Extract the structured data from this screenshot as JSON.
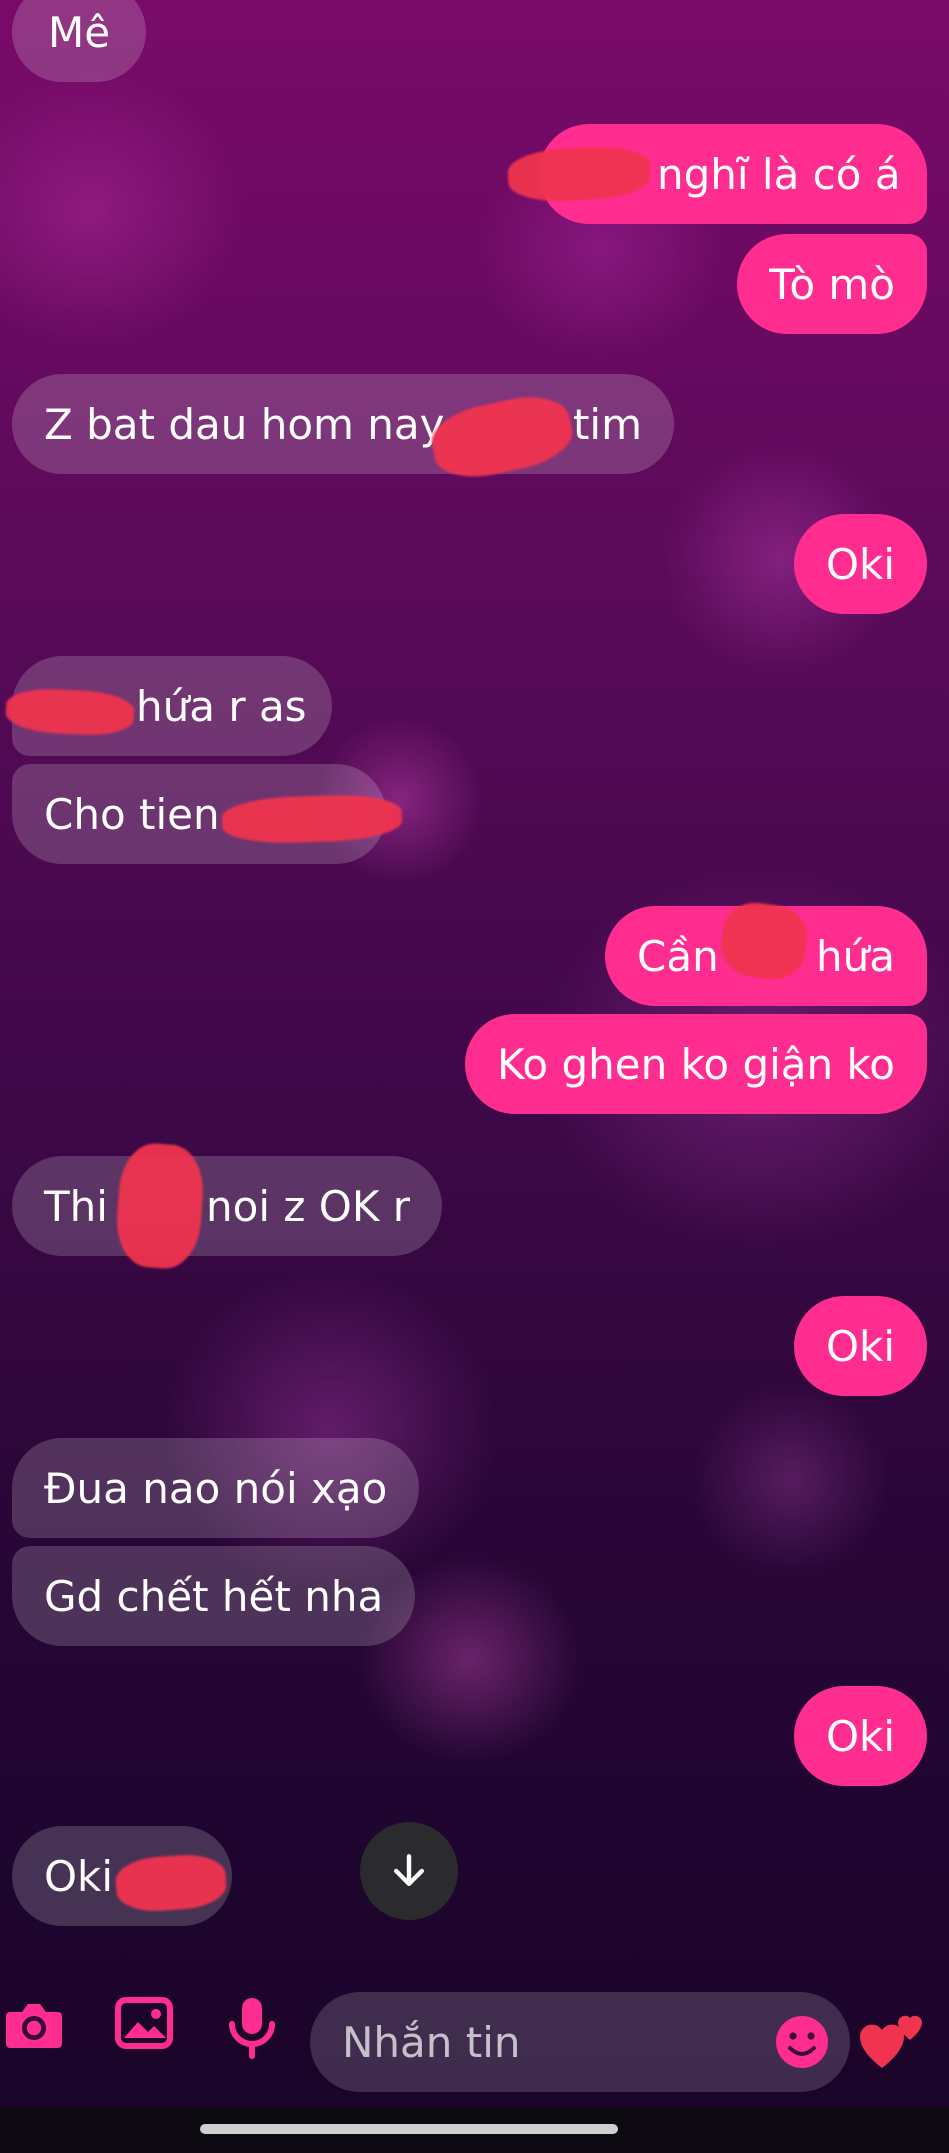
{
  "messages": [
    {
      "dir": "recv",
      "text": "Mê"
    },
    {
      "dir": "sent",
      "text": "nghĩ là có á"
    },
    {
      "dir": "sent",
      "text": "Tò mò"
    },
    {
      "dir": "recv",
      "text": "Z bat dau hom nay",
      "tail": "tim"
    },
    {
      "dir": "sent",
      "text": "Oki"
    },
    {
      "dir": "recv",
      "text": "hứa r as"
    },
    {
      "dir": "recv",
      "text": "Cho tien"
    },
    {
      "dir": "sent",
      "text": "Cần",
      "tail": "hứa"
    },
    {
      "dir": "sent",
      "text": "Ko ghen ko giận ko"
    },
    {
      "dir": "recv",
      "text": "Thi",
      "tail": "noi z OK r"
    },
    {
      "dir": "sent",
      "text": "Oki"
    },
    {
      "dir": "recv",
      "text": "Đua nao nói xạo"
    },
    {
      "dir": "recv",
      "text": "Gd chết hết nha"
    },
    {
      "dir": "sent",
      "text": "Oki"
    },
    {
      "dir": "recv",
      "text": "Oki"
    }
  ],
  "composer": {
    "placeholder": "Nhắn tin",
    "icons": [
      "camera-icon",
      "image-icon",
      "mic-icon",
      "emoji-icon",
      "heart-icon"
    ]
  },
  "scroll_down_icon": "arrow-down-icon",
  "colors": {
    "sent_bubble": "#ff2d8f",
    "recv_bubble": "rgba(255,255,255,0.18)",
    "accent": "#ff2d8f"
  }
}
